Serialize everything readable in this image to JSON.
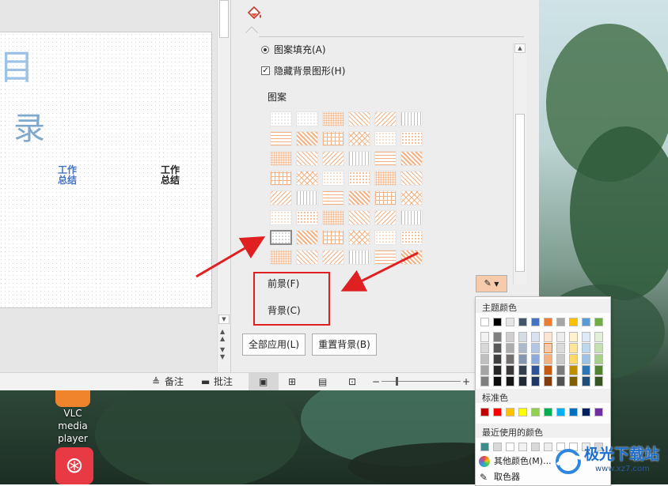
{
  "slide": {
    "char_top": "目",
    "char_mid": "录",
    "item1_line1": "工作",
    "item1_line2": "总结",
    "item2_line1": "工作",
    "item2_line2": "总结"
  },
  "panel": {
    "fill_icon": "paint-bucket-icon",
    "pattern_fill_label": "图案填充(A)",
    "hide_bg_label": "隐藏背景图形(H)",
    "pattern_section_label": "图案",
    "foreground_label": "前景(F)",
    "background_label": "背景(C)",
    "apply_all_label": "全部应用(L)",
    "reset_bg_label": "重置背景(B)"
  },
  "statusbar": {
    "notes_label": "备注",
    "comments_label": "批注",
    "zoom_minus": "−",
    "zoom_plus": "+"
  },
  "colorpicker": {
    "theme_colors_label": "主题颜色",
    "standard_colors_label": "标准色",
    "recent_colors_label": "最近使用的颜色",
    "more_colors_label": "其他颜色(M)...",
    "eyedropper_label": "取色器",
    "theme_top_row": [
      "#ffffff",
      "#000000",
      "#e7e6e6",
      "#44546a",
      "#4472c4",
      "#ed7d31",
      "#a5a5a5",
      "#ffc000",
      "#5b9bd5",
      "#70ad47"
    ],
    "theme_shades": [
      [
        "#f2f2f2",
        "#7f7f7f",
        "#d0cece",
        "#d6dce4",
        "#d9e2f3",
        "#fbe5d5",
        "#ededed",
        "#fff2cc",
        "#deebf6",
        "#e2efd9"
      ],
      [
        "#d8d8d8",
        "#595959",
        "#aeabab",
        "#adb9ca",
        "#b4c6e7",
        "#f7caac",
        "#dbdbdb",
        "#fee599",
        "#bdd7ee",
        "#c5e0b3"
      ],
      [
        "#bfbfbf",
        "#3f3f3f",
        "#757070",
        "#8496b0",
        "#8eaadb",
        "#f4b183",
        "#c9c9c9",
        "#ffd965",
        "#9cc3e5",
        "#a8d08d"
      ],
      [
        "#a5a5a5",
        "#262626",
        "#3a3838",
        "#323f4f",
        "#2f5496",
        "#c55a11",
        "#7b7b7b",
        "#bf8f00",
        "#2e75b5",
        "#538135"
      ],
      [
        "#7f7f7f",
        "#0c0c0c",
        "#171616",
        "#222a35",
        "#1f3864",
        "#833c0b",
        "#525252",
        "#7f6000",
        "#1f4e79",
        "#375623"
      ]
    ],
    "standard_colors": [
      "#c00000",
      "#ff0000",
      "#ffc000",
      "#ffff00",
      "#92d050",
      "#00b050",
      "#00b0f0",
      "#0070c0",
      "#002060",
      "#7030a0"
    ],
    "recent_colors": [
      "#3a8d8a",
      "#d9d9d9",
      "#ffffff",
      "#f2f2f2",
      "#d9d9d9",
      "#eeeeee",
      "#ffffff",
      "#ffffff",
      "#eeeeee",
      "#d9d9d9"
    ]
  },
  "desktop": {
    "vlc_label_line1": "VLC media",
    "vlc_label_line2": "player"
  },
  "watermark": {
    "text": "极光下载站",
    "url": "www.xz7.com"
  },
  "colors": {
    "accent_red": "#e02020",
    "pattern_peach": "#f4b183"
  }
}
